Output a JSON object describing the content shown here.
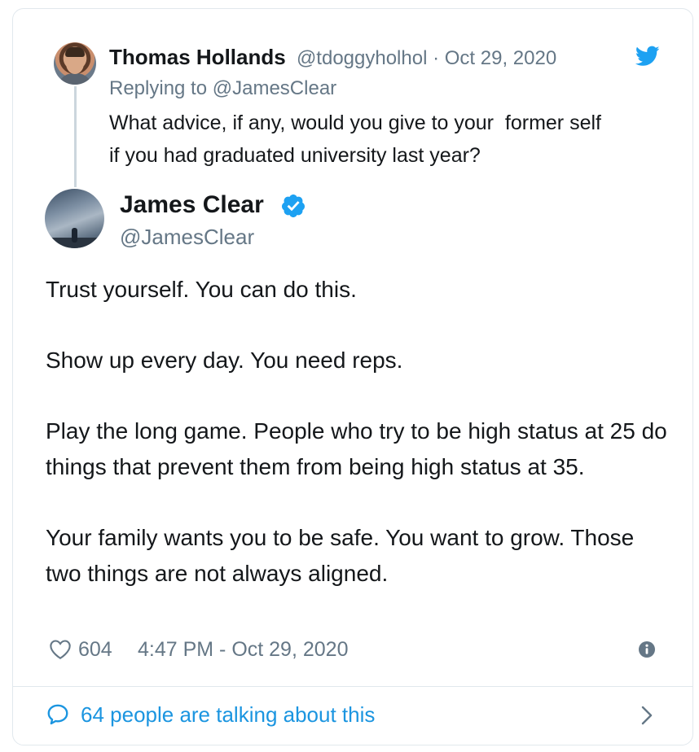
{
  "parent_tweet": {
    "author_name": "Thomas Hollands",
    "handle": "@tdoggyholhol",
    "separator": "·",
    "date": "Oct 29, 2020",
    "replying_to_label": "Replying to",
    "replying_to_handle": "@JamesClear",
    "text": "What advice, if any, would you give to your  former self\nif you had graduated university last year?",
    "avatar_icon": "user-avatar"
  },
  "main_tweet": {
    "author_name": "James Clear",
    "handle": "@JamesClear",
    "verified": true,
    "verified_icon": "verified-badge-icon",
    "paragraphs": [
      "Trust yourself. You can do this.",
      "Show up every day. You need reps.",
      "Play the long game. People who try to be high status at 25 do things that prevent them from being high status at 35.",
      "Your family wants you to be safe. You want to grow. Those two things are not always aligned."
    ],
    "like_count": "604",
    "timestamp": "4:47 PM - Oct 29, 2020"
  },
  "footer": {
    "talking_label": "64 people are talking about this"
  },
  "colors": {
    "accent": "#1da1f2",
    "link": "#1b95e0",
    "secondary_text": "#657786",
    "primary_text": "#14171a",
    "border": "#e1e8ed"
  },
  "icons": [
    "twitter-bird-icon",
    "verified-badge-icon",
    "heart-icon",
    "info-icon",
    "comment-icon",
    "chevron-right-icon"
  ]
}
